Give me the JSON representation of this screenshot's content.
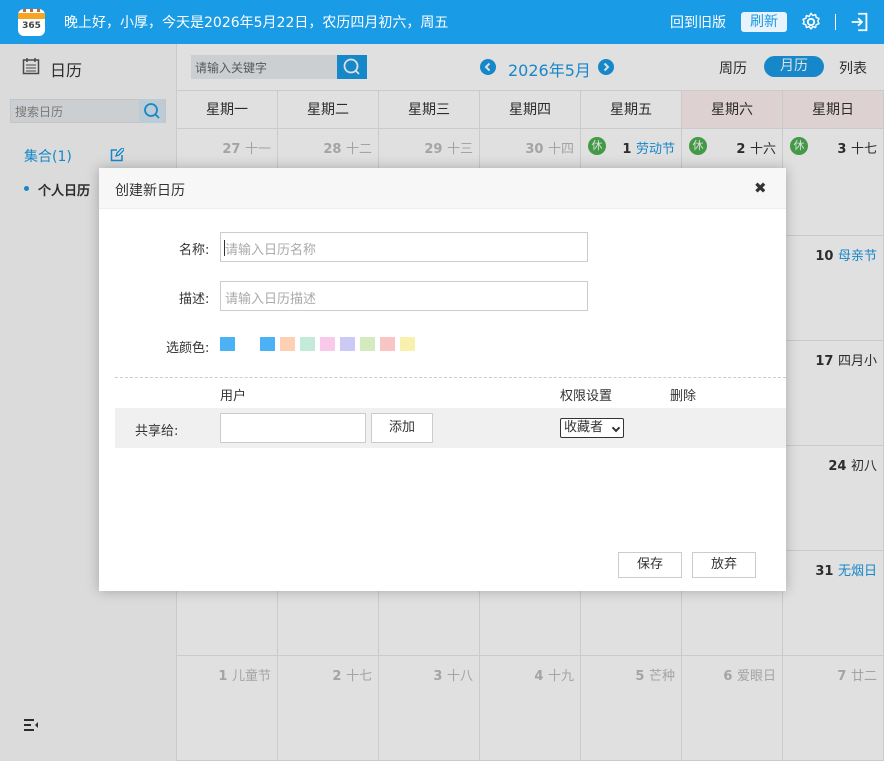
{
  "topbar": {
    "logo_text": "365",
    "greeting": "晚上好，小厚，今天是2026年5月22日，农历四月初六，周五",
    "old_version": "回到旧版",
    "refresh": "刷新"
  },
  "sidebar": {
    "title": "日历",
    "search_placeholder": "搜索日历",
    "collection": "集合(1)",
    "personal": "个人日历"
  },
  "header": {
    "keyword_placeholder": "请输入关键字",
    "month_label": "2026年5月",
    "views": {
      "week": "周历",
      "month": "月历",
      "list": "列表"
    },
    "active_view": "month"
  },
  "calendar": {
    "weekdays": [
      "星期一",
      "星期二",
      "星期三",
      "星期四",
      "星期五",
      "星期六",
      "星期日"
    ],
    "rows": [
      [
        {
          "d": "27",
          "l": "十一",
          "ot": true
        },
        {
          "d": "28",
          "l": "十二",
          "ot": true
        },
        {
          "d": "29",
          "l": "十三",
          "ot": true
        },
        {
          "d": "30",
          "l": "十四",
          "ot": true
        },
        {
          "d": "1",
          "l": "劳动节",
          "fest": true,
          "rest": "休"
        },
        {
          "d": "2",
          "l": "十六",
          "rest": "休"
        },
        {
          "d": "3",
          "l": "十七",
          "rest": "休"
        }
      ],
      [
        {},
        {},
        {},
        {},
        {},
        {},
        {
          "d": "10",
          "l": "母亲节",
          "fest": true
        }
      ],
      [
        {},
        {},
        {},
        {},
        {},
        {},
        {
          "d": "17",
          "l": "四月小"
        }
      ],
      [
        {},
        {},
        {},
        {},
        {},
        {},
        {
          "d": "24",
          "l": "初八"
        }
      ],
      [
        {},
        {},
        {},
        {},
        {},
        {},
        {
          "d": "31",
          "l": "无烟日",
          "fest": true
        }
      ],
      [
        {
          "d": "1",
          "l": "儿童节",
          "ot": true,
          "fest": true
        },
        {
          "d": "2",
          "l": "十七",
          "ot": true
        },
        {
          "d": "3",
          "l": "十八",
          "ot": true
        },
        {
          "d": "4",
          "l": "十九",
          "ot": true
        },
        {
          "d": "5",
          "l": "芒种",
          "ot": true,
          "fest": true
        },
        {
          "d": "6",
          "l": "爱眼日",
          "ot": true,
          "fest": true
        },
        {
          "d": "7",
          "l": "廿二",
          "ot": true
        }
      ]
    ]
  },
  "dialog": {
    "title": "创建新日历",
    "close_glyph": "✖",
    "name_label": "名称:",
    "name_placeholder": "请输入日历名称",
    "desc_label": "描述:",
    "desc_placeholder": "请输入日历描述",
    "color_label": "选颜色:",
    "selected_color": "#4db2f5",
    "colors": [
      "#4db2f5",
      "#fdd0b4",
      "#c4ead9",
      "#f9c9ec",
      "#cdc9f5",
      "#d4ebbf",
      "#f9c4c4",
      "#f9f0ad"
    ],
    "share": {
      "col_user": "用户",
      "col_perm": "权限设置",
      "col_delete": "删除",
      "label": "共享给:",
      "add": "添加",
      "perm_value": "收藏者"
    },
    "save": "保存",
    "cancel": "放弃"
  }
}
